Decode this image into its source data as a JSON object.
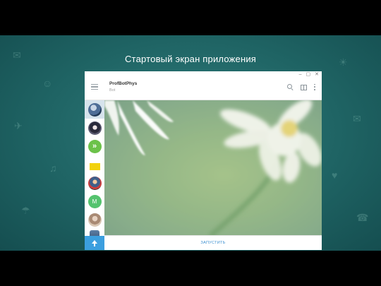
{
  "slide": {
    "title": "Стартовый экран приложения"
  },
  "window": {
    "controls": [
      "–",
      "▢",
      "✕"
    ]
  },
  "chat_header": {
    "name": "ProfBotPhys",
    "status": "Bot"
  },
  "sidebar": {
    "items": [
      {
        "icon": "avatar-1",
        "active": true
      },
      {
        "icon": "avatar-2"
      },
      {
        "icon": "forward-arrows-avatar",
        "glyph": "»"
      },
      {
        "icon": "yellow-lock-avatar"
      },
      {
        "icon": "avatar-person"
      },
      {
        "icon": "letter-avatar",
        "glyph": "M"
      },
      {
        "icon": "avatar-photo"
      },
      {
        "icon": "shield-avatar"
      }
    ],
    "bottom_button": {
      "icon": "scroll-up-icon"
    }
  },
  "footer": {
    "start_label": "ЗАПУСТИТЬ"
  },
  "colors": {
    "accent": "#3c9fdf",
    "slide_bg": "#1f6464"
  }
}
